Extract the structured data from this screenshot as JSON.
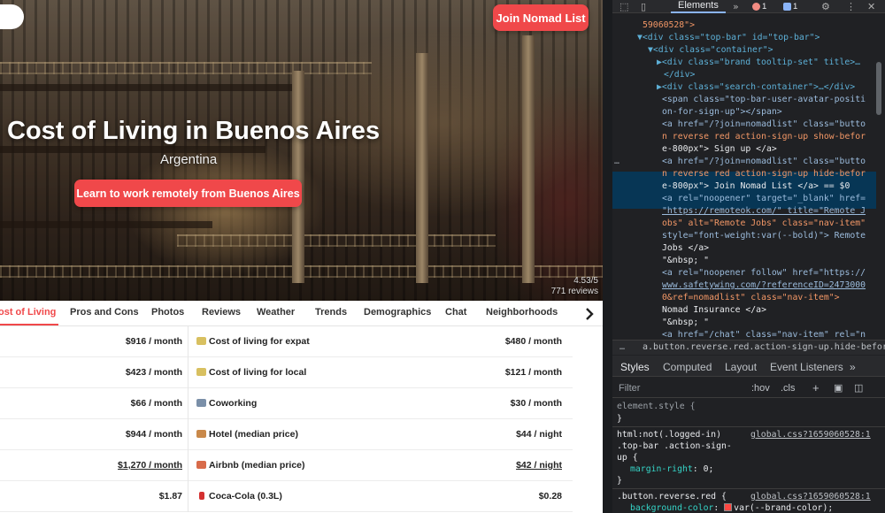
{
  "page": {
    "join_button": "Join Nomad List",
    "title": "Cost of Living in Buenos Aires",
    "country": "Argentina",
    "learn_button": "Learn to work remotely from Buenos Aires",
    "rating": "4.53/5",
    "reviews": "771 reviews",
    "tabs": [
      "ost of Living",
      "Pros and Cons",
      "Photos",
      "Reviews",
      "Weather",
      "Trends",
      "Demographics",
      "Chat",
      "Neighborhoods"
    ],
    "rows": [
      {
        "left_value": "$916 / month",
        "label": "Cost of living for expat",
        "value": "$480 / month",
        "icon": "money-icon"
      },
      {
        "left_value": "$423 / month",
        "label": "Cost of living for local",
        "value": "$121 / month",
        "icon": "money-icon"
      },
      {
        "left_value": "$66 / month",
        "label": "Coworking",
        "value": "$30 / month",
        "icon": "office-icon"
      },
      {
        "left_value": "$944 / month",
        "label": "Hotel (median price)",
        "value": "$44 / night",
        "icon": "hotel-icon"
      },
      {
        "left_value": "$1,270 / month",
        "label": "Airbnb (median price)",
        "value": "$42 / night",
        "icon": "house-icon"
      },
      {
        "left_value": "$1.87",
        "label": "Coca-Cola (0.3L)",
        "value": "$0.28",
        "icon": "cola-icon"
      }
    ]
  },
  "devtools": {
    "active_tab": "Elements",
    "error_count": "1",
    "message_count": "1",
    "dom_lines": [
      "59060528\">",
      "▼<div class=\"top-bar\" id=\"top-bar\">",
      "▼<div class=\"container\">",
      "▶<div class=\"brand tooltip-set\" title>…",
      "</div>",
      "▶<div class=\"search-container\">…</div>",
      "<span class=\"top-bar-user-avatar-positi",
      "on-for-sign-up\"></span>",
      "<a href=\"/?join=nomadlist\" class=\"butto",
      "n reverse red action-sign-up show-befor",
      "e-800px\"> Sign up </a>",
      "<a href=\"/?join=nomadlist\" class=\"butto",
      "n reverse red action-sign-up hide-befor",
      "e-800px\"> Join Nomad List </a> == $0",
      "<a rel=\"noopener\" target=\"_blank\" href=",
      "\"https://remoteok.com/\" title=\"Remote J",
      "obs\" alt=\"Remote Jobs\" class=\"nav-item\"",
      "style=\"font-weight:var(--bold)\"> Remote",
      "Jobs </a>",
      "\"&nbsp; \"",
      "<a rel=\"noopener follow\" href=\"https://",
      "www.safetywing.com/?referenceID=2473000",
      "0&ref=nomadlist\" class=\"nav-item\">",
      "Nomad Insurance </a>",
      "\"&nbsp; \"",
      "<a href=\"/chat\" class=\"nav-item\" rel=\"n"
    ],
    "breadcrumb": "a.button.reverse.red.action-sign-up.hide-before-80",
    "style_tabs": [
      "Styles",
      "Computed",
      "Layout",
      "Event Listeners"
    ],
    "filter_placeholder": "Filter",
    "hov": ":hov",
    "cls": ".cls",
    "styles": {
      "rule0_selector": "element.style {",
      "rule0_close": "}",
      "rule1_selector_l1": "html:not(.logged-in)",
      "rule1_selector_l2": ".top-bar .action-sign-",
      "rule1_selector_l3": "up {",
      "rule1_source": "global.css?1659060528:1",
      "rule1_prop": "margin-right",
      "rule1_val": "0;",
      "rule1_close": "}",
      "rule2_selector": ".button.reverse.red {",
      "rule2_source": "global.css?1659060528:1",
      "rule2_prop": "background-color",
      "rule2_val": "var(--brand-color);"
    }
  }
}
